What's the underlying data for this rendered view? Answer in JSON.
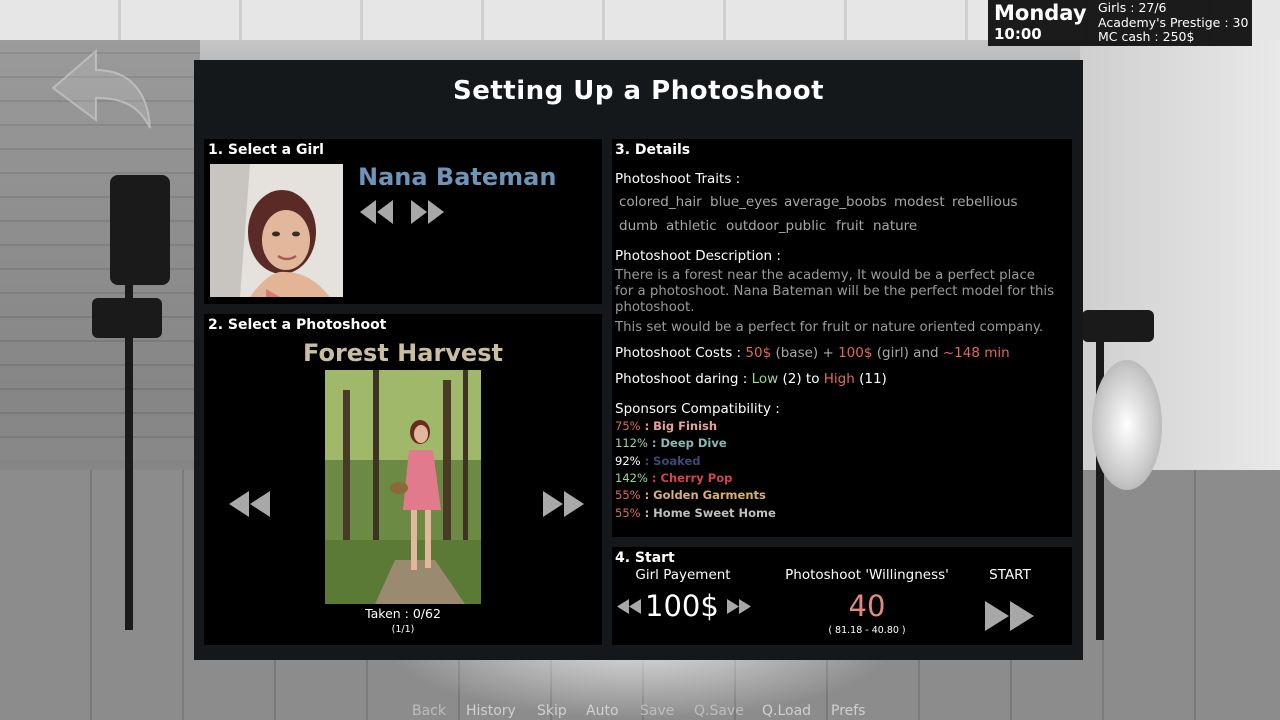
{
  "status": {
    "day": "Monday",
    "time": "10:00",
    "girls": "Girls : 27/6",
    "prestige": "Academy's Prestige : 30",
    "cash": "MC cash : 250$"
  },
  "title": "Setting Up a Photoshoot",
  "select_girl": {
    "heading": "1. Select a Girl",
    "name": "Nana Bateman"
  },
  "select_photoshoot": {
    "heading": "2. Select a Photoshoot",
    "name": "Forest Harvest",
    "taken": "Taken : 0/62",
    "taken_sub": "(1/1)"
  },
  "details": {
    "heading": "3. Details",
    "traits_label": "Photoshoot Traits :",
    "traits_row1": [
      "colored_hair",
      "blue_eyes",
      "average_boobs",
      "modest",
      "rebellious"
    ],
    "traits_row2": [
      "dumb",
      "athletic",
      "outdoor_public",
      "fruit",
      "nature"
    ],
    "desc_label": "Photoshoot Description :",
    "desc_line1": "There is a forest near the academy, It would be a perfect place",
    "desc_line2": "for a photoshoot. Nana Bateman will be the perfect model for this",
    "desc_line3": "photoshoot.",
    "desc_line4": "This set would be a perfect for fruit or nature oriented company.",
    "costs_label": "Photoshoot Costs : ",
    "cost_base": "50$",
    "cost_base_note": " (base) + ",
    "cost_girl": "100$",
    "cost_girl_note": " (girl) and ",
    "cost_time": "~148 min",
    "daring_label": "Photoshoot daring : ",
    "daring_low": "Low",
    "daring_low_val": " (2) to ",
    "daring_high": "High",
    "daring_high_val": " (11)",
    "sponsors_label": "Sponsors Compatibility :",
    "sponsors": [
      {
        "pct": "75%",
        "sep": " : ",
        "name": "Big Finish",
        "pct_color": "#e06a5a",
        "name_color": "#e8a0a0"
      },
      {
        "pct": "112%",
        "sep": " : ",
        "name": "Deep Dive",
        "pct_color": "#9bd69b",
        "name_color": "#8ab8b8"
      },
      {
        "pct": "92%",
        "sep": " : ",
        "name": "Soaked",
        "pct_color": "#ffffff",
        "name_color": "#3b4a78"
      },
      {
        "pct": "142%",
        "sep": " : ",
        "name": "Cherry Pop",
        "pct_color": "#9bd69b",
        "name_color": "#d2454f"
      },
      {
        "pct": "55%",
        "sep": " : ",
        "name": "Golden Garments",
        "pct_color": "#e06a5a",
        "name_color": "#d9b070"
      },
      {
        "pct": "55%",
        "sep": " : ",
        "name": "Home Sweet Home",
        "pct_color": "#e06a5a",
        "name_color": "#c0c0c0"
      }
    ]
  },
  "start": {
    "heading": "4. Start",
    "payment_label": "Girl Payement",
    "payment_value": "100$",
    "willingness_label": "Photoshoot 'Willingness'",
    "willingness_value": "40",
    "willingness_range": "( 81.18 - 40.80 )",
    "start_label": "START"
  },
  "menu": [
    "Back",
    "History",
    "Skip",
    "Auto",
    "Save",
    "Q.Save",
    "Q.Load",
    "Prefs"
  ]
}
